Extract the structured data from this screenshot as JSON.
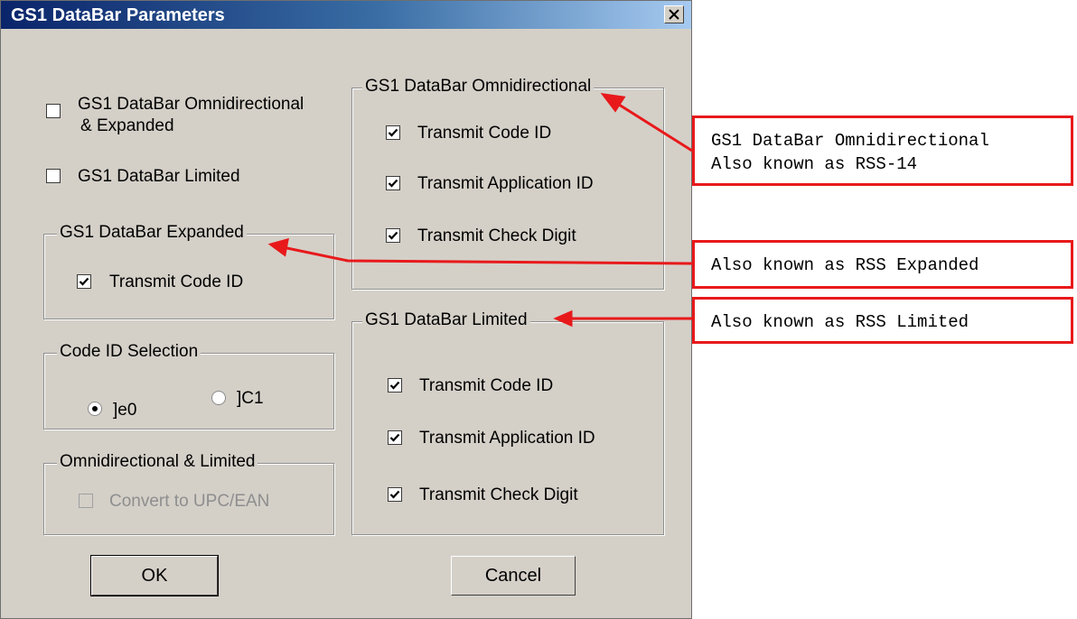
{
  "dialog": {
    "title": "GS1 DataBar Parameters",
    "close_symbol": "X"
  },
  "options": {
    "omni_expanded_line1": "GS1 DataBar Omnidirectional",
    "omni_expanded_line2": "& Expanded",
    "limited": "GS1 DataBar Limited"
  },
  "groups": {
    "expanded": {
      "title": "GS1 DataBar Expanded",
      "transmit_code_id": "Transmit Code ID"
    },
    "code_id_selection": {
      "title": "Code ID Selection",
      "option1": "]e0",
      "option2": "]C1"
    },
    "omni_limited": {
      "title": "Omnidirectional & Limited",
      "convert": "Convert to UPC/EAN"
    },
    "omnidirectional": {
      "title": "GS1 DataBar Omnidirectional",
      "transmit_code_id": "Transmit Code ID",
      "transmit_app_id": "Transmit Application ID",
      "transmit_check_digit": "Transmit Check Digit"
    },
    "limited": {
      "title": "GS1 DataBar Limited",
      "transmit_code_id": "Transmit Code ID",
      "transmit_app_id": "Transmit Application ID",
      "transmit_check_digit": "Transmit Check Digit"
    }
  },
  "buttons": {
    "ok": "OK",
    "cancel": "Cancel"
  },
  "annotations": {
    "omni_line1": "GS1 DataBar Omnidirectional",
    "omni_line2": "Also known as RSS-14",
    "expanded": "Also known as RSS Expanded",
    "limited": "Also known as RSS Limited",
    "color": "#e8191b"
  },
  "colors": {
    "dialog_bg": "#d4d0c8",
    "title_gradient_start": "#0a246a",
    "title_gradient_end": "#a6caf0"
  },
  "icons": [
    "close-icon",
    "checkmark-icon",
    "radio-dot-icon",
    "arrow-icon"
  ]
}
